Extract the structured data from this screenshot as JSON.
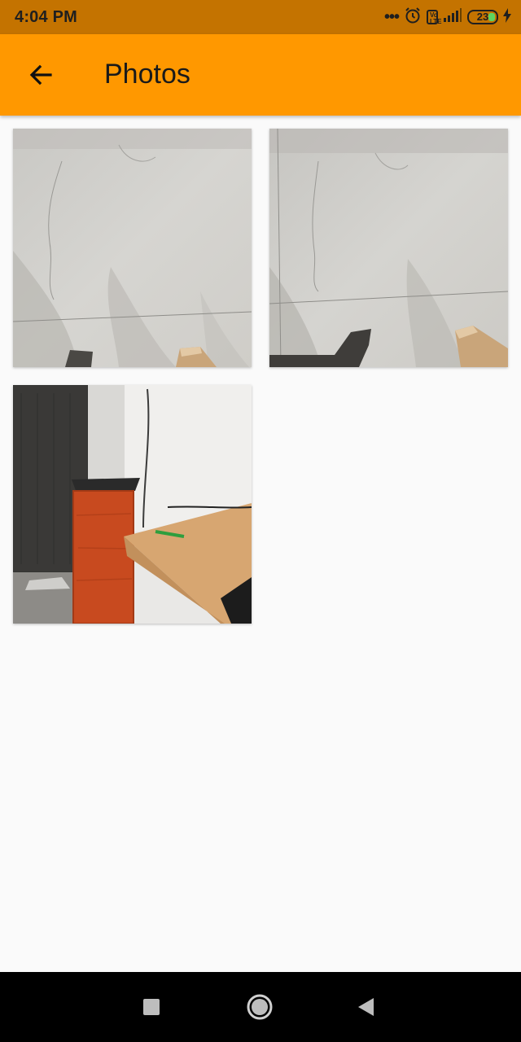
{
  "status_bar": {
    "time": "4:04 PM",
    "more": "•••",
    "volte": "Vo LTE",
    "battery_level": "23"
  },
  "appbar": {
    "title": "Photos",
    "back_icon": "arrow-back-icon"
  },
  "photos": [
    {
      "subject": "floor-tiles-with-shadows"
    },
    {
      "subject": "floor-tiles-with-shadows"
    },
    {
      "subject": "room-corner-with-desk-and-orange-cabinet"
    }
  ],
  "navbar": {
    "recents_icon": "square-icon",
    "home_icon": "circle-icon",
    "back_icon": "triangle-back-icon"
  },
  "colors": {
    "status_bar": "#c47300",
    "appbar": "#ff9800",
    "background": "#fafafa"
  }
}
